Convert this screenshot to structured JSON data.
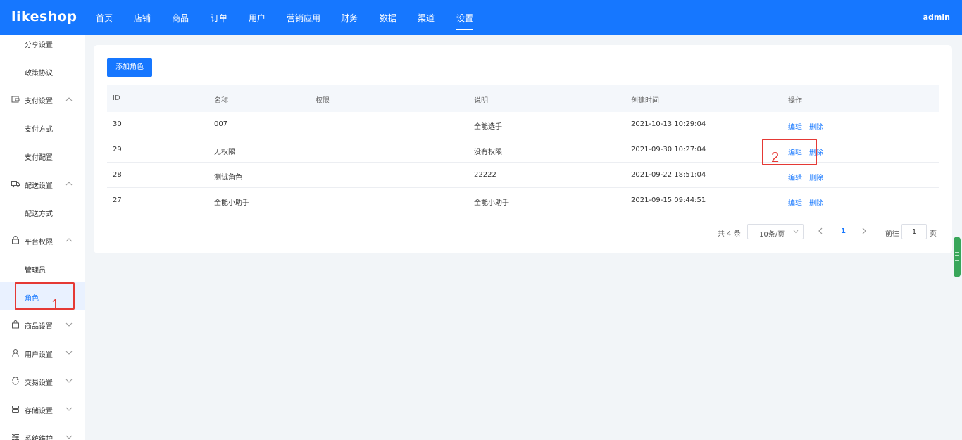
{
  "header": {
    "logo": "likeshop",
    "nav": [
      "首页",
      "店铺",
      "商品",
      "订单",
      "用户",
      "营销应用",
      "财务",
      "数据",
      "渠道",
      "设置"
    ],
    "active_nav": "设置",
    "user": "admin",
    "brand_color": "#1677ff"
  },
  "sidebar": {
    "items": [
      {
        "label": "分享设置",
        "kind": "sub"
      },
      {
        "label": "政策协议",
        "kind": "sub"
      },
      {
        "label": "支付设置",
        "kind": "group",
        "icon": "payment-icon",
        "expanded": true
      },
      {
        "label": "支付方式",
        "kind": "sub"
      },
      {
        "label": "支付配置",
        "kind": "sub"
      },
      {
        "label": "配送设置",
        "kind": "group",
        "icon": "truck-icon",
        "expanded": true
      },
      {
        "label": "配送方式",
        "kind": "sub"
      },
      {
        "label": "平台权限",
        "kind": "group",
        "icon": "lock-icon",
        "expanded": true
      },
      {
        "label": "管理员",
        "kind": "sub"
      },
      {
        "label": "角色",
        "kind": "sub",
        "selected": true
      },
      {
        "label": "商品设置",
        "kind": "group",
        "icon": "bag-icon",
        "expanded": false
      },
      {
        "label": "用户设置",
        "kind": "group",
        "icon": "user-icon",
        "expanded": false
      },
      {
        "label": "交易设置",
        "kind": "group",
        "icon": "exchange-icon",
        "expanded": false
      },
      {
        "label": "存储设置",
        "kind": "group",
        "icon": "storage-icon",
        "expanded": false
      },
      {
        "label": "系统维护",
        "kind": "group",
        "icon": "maintenance-icon",
        "expanded": false
      }
    ]
  },
  "main": {
    "add_button": "添加角色",
    "columns": [
      "ID",
      "名称",
      "权限",
      "说明",
      "创建时间",
      "操作"
    ],
    "rows": [
      {
        "id": "30",
        "name": "007",
        "perm": "",
        "desc": "全能选手",
        "created": "2021-10-13 10:29:04",
        "edit": "编辑",
        "delete": "删除"
      },
      {
        "id": "29",
        "name": "无权限",
        "perm": "",
        "desc": "没有权限",
        "created": "2021-09-30 10:27:04",
        "edit": "编辑",
        "delete": "删除"
      },
      {
        "id": "28",
        "name": "测试角色",
        "perm": "",
        "desc": "22222",
        "created": "2021-09-22 18:51:04",
        "edit": "编辑",
        "delete": "删除"
      },
      {
        "id": "27",
        "name": "全能小助手",
        "perm": "",
        "desc": "全能小助手",
        "created": "2021-09-15 09:44:51",
        "edit": "编辑",
        "delete": "删除"
      }
    ]
  },
  "pagination": {
    "total": "共 4 条",
    "page_size": "10条/页",
    "current_page": "1",
    "goto_label": "前往",
    "goto_value": "1",
    "page_suffix": "页"
  },
  "annotations": {
    "label_1": "1",
    "label_2": "2",
    "color": "#e53935"
  }
}
